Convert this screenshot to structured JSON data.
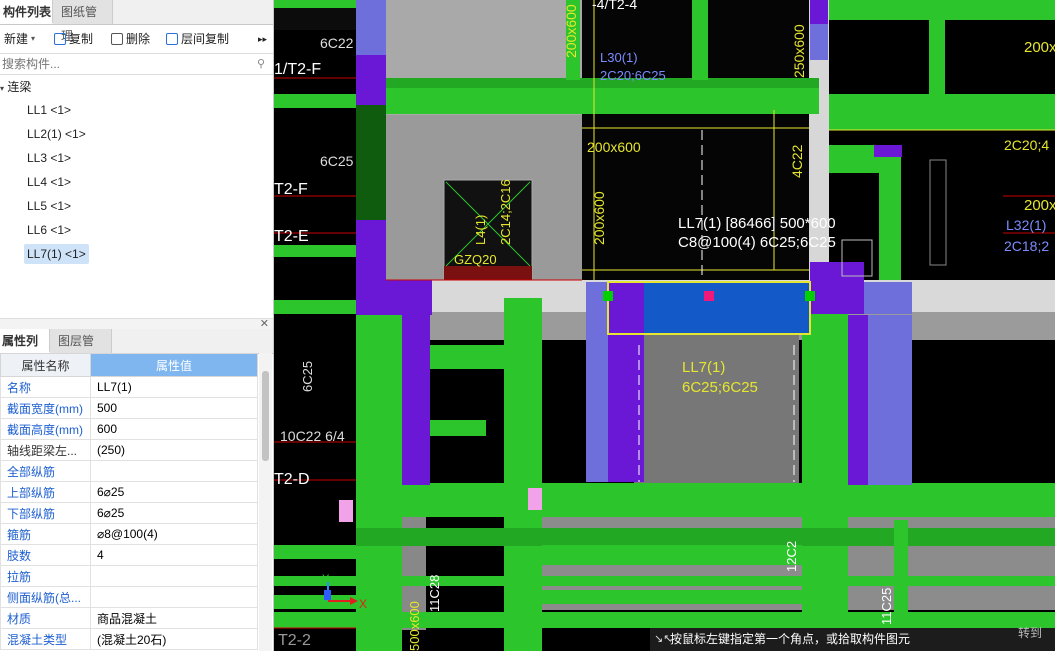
{
  "component_panel": {
    "tabs": [
      "构件列表",
      "图纸管理"
    ],
    "toolbar": {
      "new": "新建",
      "copy": "复制",
      "delete": "删除",
      "floor_copy": "层间复制",
      "more": "▸▸"
    },
    "search_placeholder": "搜索构件...",
    "tree": {
      "root": "连梁",
      "items": [
        "LL1 <1>",
        "LL2(1) <1>",
        "LL3 <1>",
        "LL4 <1>",
        "LL5 <1>",
        "LL6 <1>",
        "LL7(1) <1>"
      ],
      "selected_index": 6
    }
  },
  "property_panel": {
    "tabs": [
      "属性列表",
      "图层管理"
    ],
    "header": {
      "name": "属性名称",
      "value": "属性值"
    },
    "rows": [
      {
        "name": "名称",
        "value": "LL7(1)"
      },
      {
        "name": "截面宽度(mm)",
        "value": "500"
      },
      {
        "name": "截面高度(mm)",
        "value": "600"
      },
      {
        "name": "轴线距梁左...",
        "value": "(250)"
      },
      {
        "name": "全部纵筋",
        "value": ""
      },
      {
        "name": "上部纵筋",
        "value": "6⌀25"
      },
      {
        "name": "下部纵筋",
        "value": "6⌀25"
      },
      {
        "name": "箍筋",
        "value": "⌀8@100(4)"
      },
      {
        "name": "肢数",
        "value": "4"
      },
      {
        "name": "拉筋",
        "value": ""
      },
      {
        "name": "侧面纵筋(总...",
        "value": ""
      },
      {
        "name": "材质",
        "value": "商品混凝土"
      },
      {
        "name": "混凝土类型",
        "value": "(混凝土20石)"
      }
    ]
  },
  "canvas": {
    "labels": {
      "top_axis": "-4/T2-4",
      "axis_t2f": "1/T2-F",
      "t2f": "T2-F",
      "t2e": "T2-E",
      "t2d": "T2-D",
      "t22": "T2-2",
      "b6c22": "6C22",
      "b6c25": "6C25",
      "lb10c22": "10C22 6/4",
      "l30": "L30(1)",
      "l30b": "2C20;6C25",
      "s200x600a": "200x600",
      "s200x600b": "200x600",
      "s200x600v": "200x600",
      "s250x600": "250x600",
      "s4c22": "4C22",
      "l4": "L4(1)",
      "l4b": "2C14;2C16",
      "gzq": "GZQ20",
      "info1": "LL7(1) [86466] 500*600",
      "info2": "C8@100(4) 6C25;6C25",
      "ll7": "LL7(1)",
      "ll7b": "6C25;6C25",
      "r200a": "200x",
      "r2c20": "2C20;4",
      "r200b": "200x",
      "l32": "L32(1)",
      "r2c18": "2C18;2",
      "v12c2": "12C2",
      "v11c28": "11C28",
      "v500x600": "500x600",
      "v11c25": "11C25",
      "v6c25": "6C25",
      "axis_x": "X",
      "axis_y": "Y"
    },
    "status_message": "按鼠标左键指定第一个角点，或拾取构件图元",
    "corner_text": "转到"
  },
  "colors": {
    "beam_green": "#2cc52c",
    "dark_green": "#0f5c0f",
    "wall_gray": "#a9a9a9",
    "column_purple": "#6a18d6",
    "column_blue_purple": "#6f6fdc",
    "selection_blue": "#1459c8",
    "text_white": "#ffffff",
    "cad_yellow": "#e6e62e",
    "panel_header_blue": "#7fb6f0",
    "label_blue": "#1d5fd0"
  }
}
